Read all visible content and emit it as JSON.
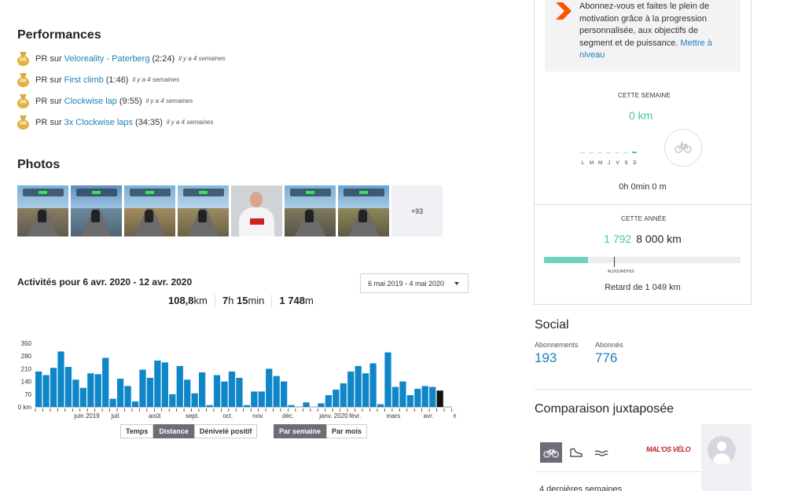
{
  "performances": {
    "title": "Performances",
    "medal_label": "PR",
    "items": [
      {
        "prefix": "PR sur",
        "segment": "Veloreality - Paterberg",
        "time": "(2:24)",
        "ago": "il y a 4 semaines"
      },
      {
        "prefix": "PR sur",
        "segment": "First climb",
        "time": "(1:46)",
        "ago": "il y a 4 semaines"
      },
      {
        "prefix": "PR sur",
        "segment": "Clockwise lap",
        "time": "(9:55)",
        "ago": "il y a 4 semaines"
      },
      {
        "prefix": "PR sur",
        "segment": "3x Clockwise laps",
        "time": "(34:35)",
        "ago": "il y a 4 semaines"
      }
    ]
  },
  "photos": {
    "title": "Photos",
    "more_label": "+93"
  },
  "activities": {
    "title": "Activités pour 6 avr. 2020 - 12 avr. 2020",
    "date_range": "6 mai 2019 - 4 mai 2020",
    "distance_num": "108,8",
    "distance_unit": "km",
    "time_h": "7",
    "time_h_unit": "h ",
    "time_m": "15",
    "time_m_unit": "min",
    "elev_num": "1 748",
    "elev_unit": "m",
    "metric_toggles": [
      "Temps",
      "Distance",
      "Dénivelé positif"
    ],
    "period_toggles": [
      "Par semaine",
      "Par mois"
    ],
    "active_metric": "Distance",
    "active_period": "Par semaine"
  },
  "chart_data": {
    "type": "bar",
    "unit": "km",
    "y_ticks": [
      "350",
      "280",
      "210",
      "140",
      "70",
      "0 km"
    ],
    "ylim": [
      0,
      350
    ],
    "month_labels": [
      "juin 2019",
      "juil.",
      "août",
      "sept.",
      "oct.",
      "nov.",
      "déc.",
      "janv. 2020",
      "févr.",
      "mars",
      "avr.",
      "mai"
    ],
    "values": [
      195,
      175,
      215,
      305,
      220,
      150,
      105,
      185,
      180,
      270,
      45,
      155,
      115,
      30,
      205,
      160,
      255,
      245,
      70,
      225,
      150,
      75,
      190,
      10,
      175,
      140,
      195,
      160,
      10,
      85,
      85,
      210,
      170,
      140,
      10,
      0,
      25,
      0,
      20,
      65,
      95,
      130,
      195,
      225,
      185,
      240,
      15,
      300,
      110,
      140,
      65,
      100,
      115,
      110,
      90
    ],
    "colors": {
      "bar": "#0f86c7",
      "current": "#111111"
    }
  },
  "upgrade": {
    "text": "Abonnez-vous et faites le plein de motivation grâce à la progression personnalisée, aux objectifs de segment et de puissance.",
    "link": "Mettre à niveau"
  },
  "this_week": {
    "label": "CETTE SEMAINE",
    "distance": "0 km",
    "days": [
      "L",
      "M",
      "M",
      "J",
      "V",
      "S",
      "D"
    ],
    "summary": "0h 0min 0 m"
  },
  "this_year": {
    "label": "CETTE ANNÉE",
    "done": "1 792",
    "goal": "8 000 km",
    "progress": 0.224,
    "today_label": "AUJOURD'HUI",
    "late": "Retard de 1 049 km"
  },
  "social": {
    "title": "Social",
    "following_label": "Abonnements",
    "following": "193",
    "followers_label": "Abonnés",
    "followers": "776"
  },
  "compare": {
    "title": "Comparaison juxtaposée",
    "club_name": "MAL'OS VÉLO",
    "last_weeks": "4 dernières semaines"
  },
  "colors": {
    "accent": "#fc5200",
    "link": "#1f7fb8",
    "green": "#4bc0a8",
    "bar": "#0f86c7"
  }
}
